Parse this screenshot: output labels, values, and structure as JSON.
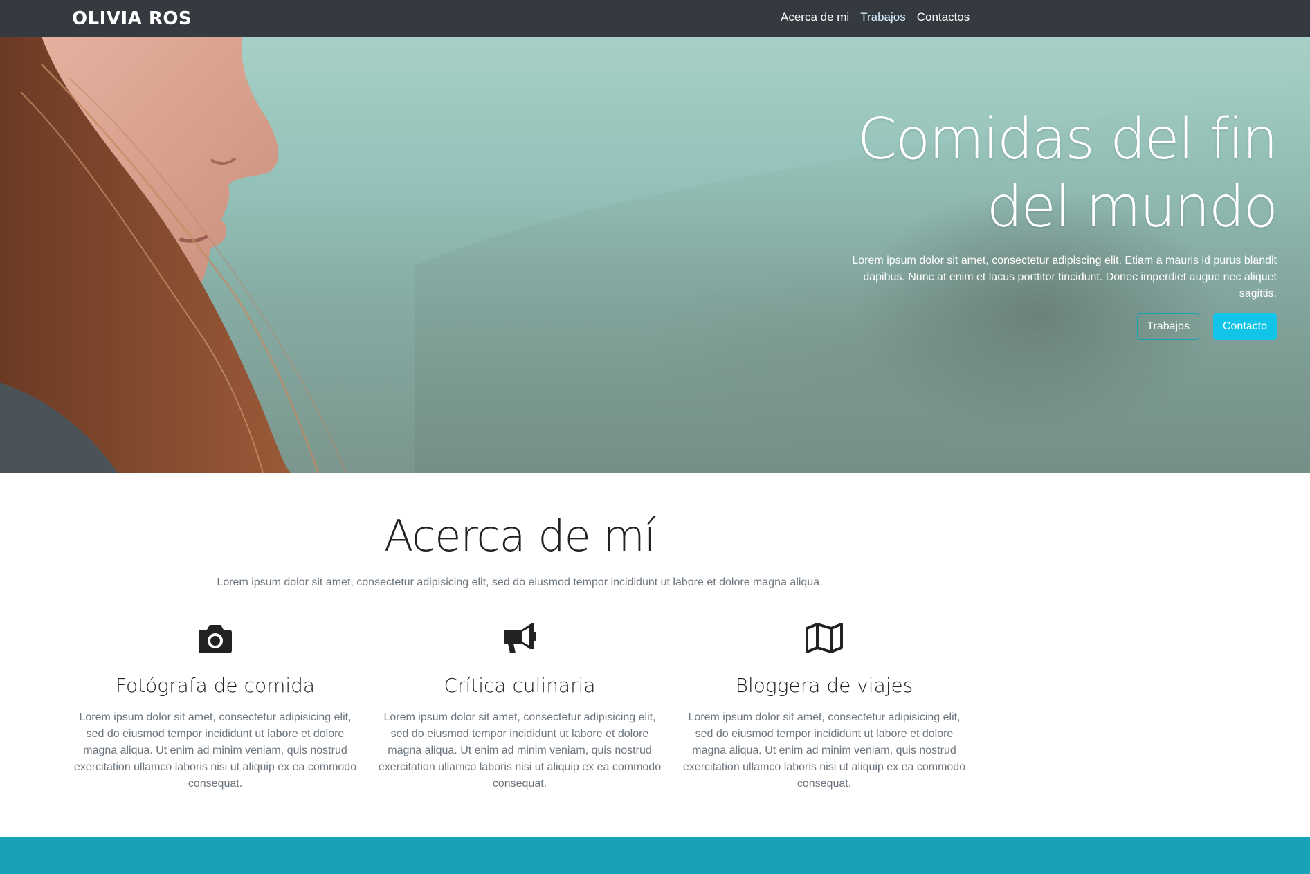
{
  "navbar": {
    "brand": "OLIVIA ROS",
    "links": [
      {
        "label": "Acerca de mi"
      },
      {
        "label": "Trabajos"
      },
      {
        "label": "Contactos"
      }
    ]
  },
  "hero": {
    "title": "Comidas del fin del mundo",
    "lead": "Lorem ipsum dolor sit amet, consectetur adipiscing elit. Etiam a mauris id purus blandit dapibus. Nunc at enim et lacus porttitor tincidunt. Donec imperdiet augue nec aliquet sagittis.",
    "buttons": {
      "trabajos": "Trabajos",
      "contacto": "Contacto"
    }
  },
  "about": {
    "title": "Acerca de mí",
    "lead": "Lorem ipsum dolor sit amet, consectetur adipisicing elit, sed do eiusmod tempor incididunt ut labore et dolore magna aliqua.",
    "features": [
      {
        "icon": "camera-icon",
        "title": "Fotógrafa de comida",
        "text": "Lorem ipsum dolor sit amet, consectetur adipisicing elit, sed do eiusmod tempor incididunt ut labore et dolore magna aliqua. Ut enim ad minim veniam, quis nostrud exercitation ullamco laboris nisi ut aliquip ex ea commodo consequat."
      },
      {
        "icon": "megaphone-icon",
        "title": "Crítica culinaria",
        "text": "Lorem ipsum dolor sit amet, consectetur adipisicing elit, sed do eiusmod tempor incididunt ut labore et dolore magna aliqua. Ut enim ad minim veniam, quis nostrud exercitation ullamco laboris nisi ut aliquip ex ea commodo consequat."
      },
      {
        "icon": "map-icon",
        "title": "Bloggera de viajes",
        "text": "Lorem ipsum dolor sit amet, consectetur adipisicing elit, sed do eiusmod tempor incididunt ut labore et dolore magna aliqua. Ut enim ad minim veniam, quis nostrud exercitation ullamco laboris nisi ut aliquip ex ea commodo consequat."
      }
    ]
  },
  "colors": {
    "navbar": "#343a40",
    "accent": "#17a2b8",
    "button_info": "#11c4e8",
    "hero_tint": "#93c1b9"
  }
}
